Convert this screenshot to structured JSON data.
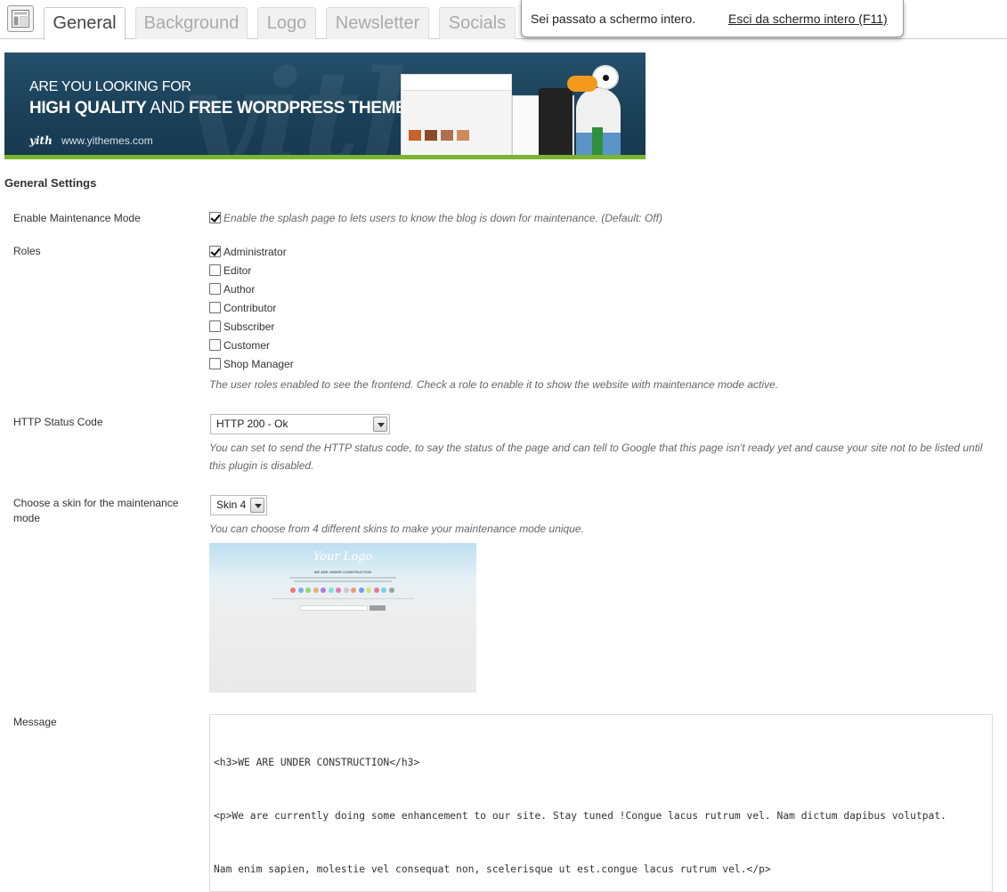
{
  "tabs": [
    {
      "label": "General",
      "active": true
    },
    {
      "label": "Background",
      "active": false
    },
    {
      "label": "Logo",
      "active": false
    },
    {
      "label": "Newsletter",
      "active": false
    },
    {
      "label": "Socials",
      "active": false
    }
  ],
  "fullscreen_notice": {
    "message": "Sei passato a schermo intero.",
    "exit_link": "Esci da schermo intero (F11)"
  },
  "banner": {
    "line1": "ARE YOU LOOKING FOR",
    "line2_bold_1": "HIGH QUALITY",
    "line2_mid": " AND ",
    "line2_bold_2": "FREE WORDPRESS THEMES?",
    "brand": "yith",
    "url": "www.yithemes.com",
    "watermark": "yith"
  },
  "settings": {
    "title": "General Settings",
    "maintenance": {
      "label": "Enable Maintenance Mode",
      "checked": true,
      "description": "Enable the splash page to lets users to know the blog is down for maintenance. (Default: Off)"
    },
    "roles": {
      "label": "Roles",
      "items": [
        {
          "label": "Administrator",
          "checked": true
        },
        {
          "label": "Editor",
          "checked": false
        },
        {
          "label": "Author",
          "checked": false
        },
        {
          "label": "Contributor",
          "checked": false
        },
        {
          "label": "Subscriber",
          "checked": false
        },
        {
          "label": "Customer",
          "checked": false
        },
        {
          "label": "Shop Manager",
          "checked": false
        }
      ],
      "description": "The user roles enabled to see the frontend. Check a role to enable it to show the website with maintenance mode active."
    },
    "http_status": {
      "label": "HTTP Status Code",
      "selected": "HTTP 200 - Ok",
      "description_1": "You can set to send the HTTP status code, to say the status of the page and can tell to Google that this page isn't ready yet and cause your site not to be listed until",
      "description_2": "this plugin is disabled."
    },
    "skin": {
      "label_1": "Choose a skin for the maintenance",
      "label_2": "mode",
      "selected": "Skin 4",
      "description": "You can choose from 4 different skins to make your maintenance mode unique.",
      "preview_logo": "Your Logo",
      "preview_heading": "WE ARE UNDER CONSTRUCTION",
      "preview_dot_colors": [
        "#e57a7a",
        "#7ab0e5",
        "#9ad07a",
        "#e5b07a",
        "#b07ae5",
        "#7ae5d0",
        "#e57ab8",
        "#c9c9c9",
        "#e59a7a",
        "#7a9ae5",
        "#d0e57a",
        "#e57a9a",
        "#7ad0e5",
        "#a0a0a0"
      ]
    },
    "message": {
      "label": "Message",
      "lines": [
        "<h3>WE ARE UNDER CONSTRUCTION</h3>",
        "<p>We are currently doing some enhancement to our site. Stay tuned !Congue lacus rutrum vel. Nam dictum dapibus volutpat.",
        "Nam enim sapien, molestie vel consequat non, scelerisque ut est.congue lacus rutrum vel.</p>"
      ]
    }
  }
}
